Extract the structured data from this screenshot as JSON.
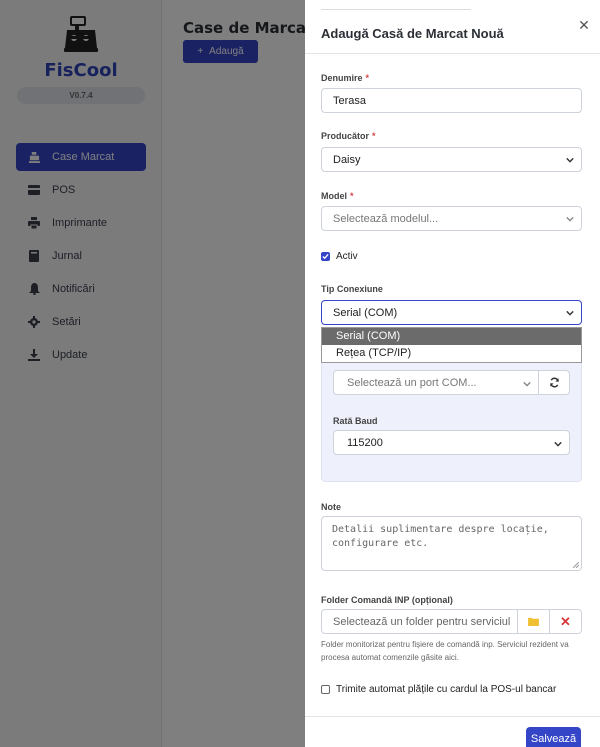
{
  "sidebar": {
    "brand": "FisCool",
    "version": "V0.7.4",
    "items": [
      {
        "label": "Case Marcat",
        "icon": "cash-register-icon",
        "active": true
      },
      {
        "label": "POS",
        "icon": "card-icon"
      },
      {
        "label": "Imprimante",
        "icon": "printer-icon"
      },
      {
        "label": "Jurnal",
        "icon": "book-icon"
      },
      {
        "label": "Notificări",
        "icon": "bell-icon"
      },
      {
        "label": "Setări",
        "icon": "gear-icon"
      },
      {
        "label": "Update",
        "icon": "download-icon"
      }
    ]
  },
  "main": {
    "title": "Case de Marcat",
    "add_label": "Adaugă"
  },
  "panel": {
    "title": "Adaugă Casă de Marcat Nouă",
    "denumire": {
      "label": "Denumire",
      "value": "Terasa"
    },
    "producator": {
      "label": "Producător",
      "value": "Daisy"
    },
    "model": {
      "label": "Model",
      "placeholder": "Selectează modelul..."
    },
    "activ": {
      "label": "Activ",
      "checked": true
    },
    "tip_conexiune": {
      "label": "Tip Conexiune",
      "value": "Serial (COM)",
      "options": [
        "Serial (COM)",
        "Rețea (TCP/IP)"
      ]
    },
    "com_port": {
      "placeholder": "Selectează un port COM..."
    },
    "baud": {
      "label": "Rată Baud",
      "value": "115200"
    },
    "note": {
      "label": "Note",
      "placeholder": "Detalii suplimentare despre locație, configurare etc."
    },
    "folder": {
      "label": "Folder Comandă INP (opțional)",
      "placeholder": "Selectează un folder pentru serviciul",
      "help": "Folder monitorizat pentru fișiere de comandă inp. Serviciul rezident va procesa automat comenzile găsite aici."
    },
    "pos_check": {
      "label": "Trimite automat plățile cu cardul la POS-ul bancar",
      "checked": false
    },
    "save_label": "Salvează"
  },
  "colors": {
    "accent": "#3445c8",
    "danger": "#d64545"
  }
}
